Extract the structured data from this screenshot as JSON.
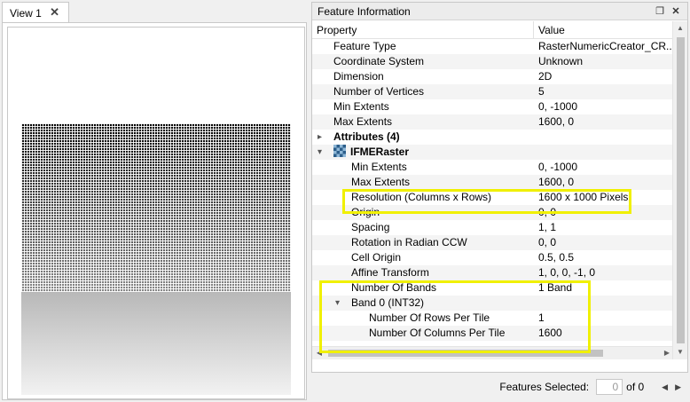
{
  "view_tab": {
    "label": "View 1",
    "close": "✕"
  },
  "panel": {
    "title": "Feature Information",
    "float_icon": "❐",
    "close_icon": "✕",
    "columns": {
      "property": "Property",
      "value": "Value"
    },
    "rows": [
      {
        "property": "Feature Type",
        "value": "RasterNumericCreator_CR..."
      },
      {
        "property": "Coordinate System",
        "value": "Unknown"
      },
      {
        "property": "Dimension",
        "value": "2D"
      },
      {
        "property": "Number of Vertices",
        "value": "5"
      },
      {
        "property": "Min Extents",
        "value": "0, -1000"
      },
      {
        "property": "Max Extents",
        "value": "1600, 0"
      },
      {
        "property": "Attributes (4)",
        "value": ""
      },
      {
        "property": "IFMERaster",
        "value": ""
      },
      {
        "property": "Min Extents",
        "value": "0, -1000"
      },
      {
        "property": "Max Extents",
        "value": "1600, 0"
      },
      {
        "property": "Resolution (Columns x Rows)",
        "value": "1600 x 1000 Pixels"
      },
      {
        "property": "Origin",
        "value": "0, 0"
      },
      {
        "property": "Spacing",
        "value": "1, 1"
      },
      {
        "property": "Rotation in Radian CCW",
        "value": "0, 0"
      },
      {
        "property": "Cell Origin",
        "value": "0.5, 0.5"
      },
      {
        "property": "Affine Transform",
        "value": "1, 0, 0, -1, 0"
      },
      {
        "property": "Number Of Bands",
        "value": "1 Band"
      },
      {
        "property": "Band 0 (INT32)",
        "value": ""
      },
      {
        "property": "Number Of Rows Per Tile",
        "value": "1"
      },
      {
        "property": "Number Of Columns Per Tile",
        "value": "1600"
      }
    ]
  },
  "status": {
    "features_selected_label": "Features Selected:",
    "selected_count": "0",
    "of_total": "of 0"
  },
  "colors": {
    "highlight": "#f0f000"
  }
}
